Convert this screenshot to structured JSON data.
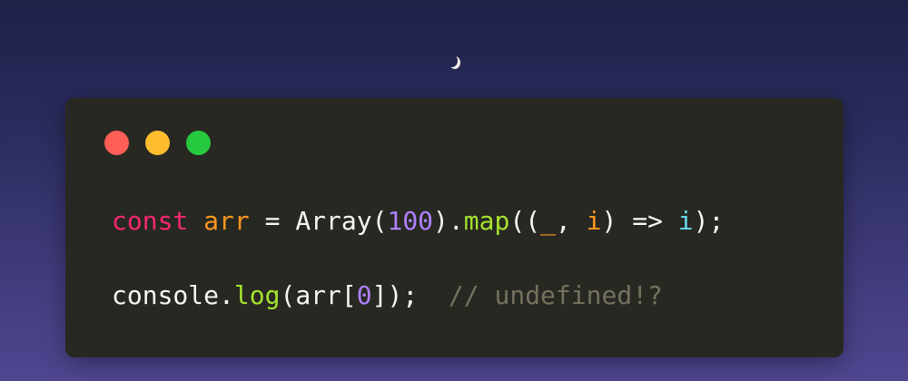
{
  "colors": {
    "keyword": "#f92672",
    "variable": "#fd971f",
    "plain": "#f8f8f2",
    "number": "#ae81ff",
    "function": "#a6e22e",
    "param_i": "#66d9ef",
    "comment": "#75715e",
    "window_bg": "#272822",
    "dot_close": "#ff5f56",
    "dot_minimize": "#ffbd2e",
    "dot_zoom": "#27c93f"
  },
  "window": {
    "controls": [
      "close-dot",
      "minimize-dot",
      "zoom-dot"
    ]
  },
  "code": {
    "line1": {
      "kw_const": "const",
      "sp1": " ",
      "var_arr": "arr",
      "assign": " = ",
      "array_ctor": "Array",
      "paren_open": "(",
      "num_100": "100",
      "paren_close_dot": ").",
      "fn_map": "map",
      "parens_open": "((",
      "param_underscore": "_",
      "comma": ", ",
      "param_i": "i",
      "arrow": ") => ",
      "ret_i": "i",
      "end": ");"
    },
    "line2": {
      "console": "console",
      "dot": ".",
      "fn_log": "log",
      "paren_open": "(",
      "arr": "arr",
      "bracket_open": "[",
      "num_0": "0",
      "close": "]);",
      "spacer": "  ",
      "comment": "// undefined!?"
    }
  },
  "decor": {
    "moon_icon": "crescent-moon"
  }
}
